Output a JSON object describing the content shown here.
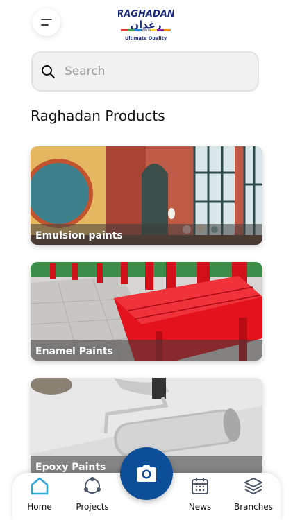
{
  "header": {
    "logo_text_top": "RAGHADAN",
    "logo_text_arabic": "رغدان",
    "logo_paints": "PAINTS",
    "logo_tagline": "Ultimate Quality"
  },
  "search": {
    "placeholder": "Search"
  },
  "section_title": "Raghadan Products",
  "products": [
    {
      "label": "Emulsion paints"
    },
    {
      "label": "Enamel Paints"
    },
    {
      "label": "Epoxy Paints"
    }
  ],
  "nav": {
    "items": [
      {
        "label": "Home"
      },
      {
        "label": "Projects"
      },
      {
        "label": "News"
      },
      {
        "label": "Branches"
      }
    ]
  },
  "colors": {
    "accent_blue": "#0d4e99",
    "home_icon_active": "#29a9e0",
    "nav_icon": "#4a5568"
  }
}
